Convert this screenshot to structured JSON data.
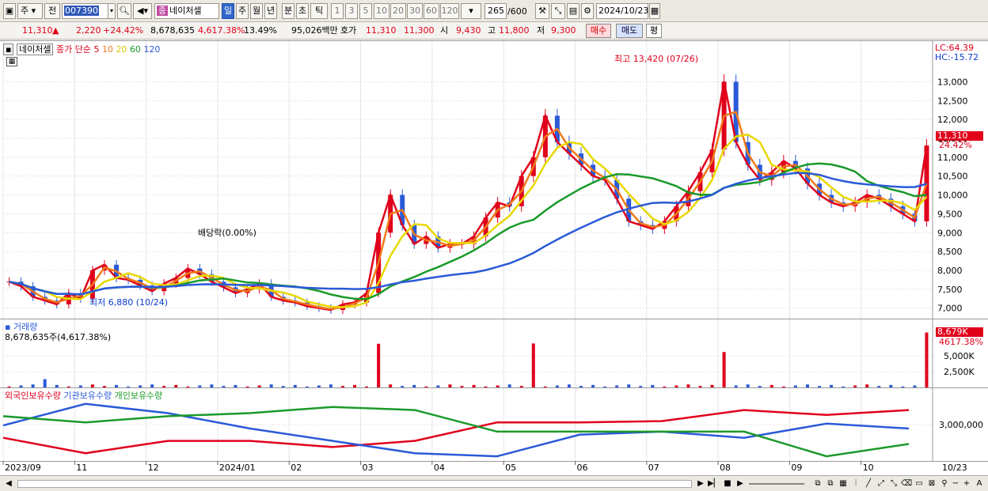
{
  "toolbar": {
    "period_select": "주",
    "prev_label": "전",
    "stock_code": "007390",
    "badge": "종",
    "stock_name": "네이처셀",
    "periods": [
      "일",
      "주",
      "월",
      "년",
      "분",
      "초",
      "틱"
    ],
    "active_period": "일",
    "intervals": [
      "1",
      "3",
      "5",
      "10",
      "20",
      "30",
      "60",
      "120"
    ],
    "count": "265",
    "count_total": "/600",
    "date": "2024/10/23"
  },
  "info": {
    "price": "11,310",
    "change_arrow": "▲",
    "change": "2,220",
    "change_pct": "+24.42%",
    "volume": "8,678,635",
    "volume_pct": "4,617.38%",
    "turnover": "13.49%",
    "amount": "95,026백만",
    "bid_label": "호가",
    "bid1": "11,310",
    "bid2": "11,300",
    "open_label": "시",
    "open": "9,430",
    "high_label": "고",
    "high": "11,800",
    "low_label": "저",
    "low": "9,300",
    "buy_label": "매수",
    "sell_label": "매도",
    "eval_label": "평"
  },
  "price_panel": {
    "name": "네이처셀",
    "legend_prefix": "종가 단순",
    "ma_labels": [
      "5",
      "10",
      "20",
      "60",
      "120"
    ],
    "ma_colors": [
      "#e0001b",
      "#f07a1a",
      "#e8d800",
      "#1a9a2a",
      "#2a5ad8"
    ],
    "lc_label": "LC:64.39",
    "hc_label": "HC:-15.72",
    "high_annot": "최고 13,420 (07/26)",
    "low_annot": "최저 6,880 (10/24)",
    "dividend_annot": "배당락(0.00%)",
    "current_price_tag": "11,310",
    "current_pct_tag": "24.42%"
  },
  "volume_panel": {
    "title": "거래량",
    "value": "8,678,635주(4,617.38%)",
    "tag_value": "8,679K",
    "tag_pct": "4617.38%"
  },
  "holding_panel": {
    "legend": [
      "외국인보유수량",
      "기관보유수량",
      "개인보유수량"
    ],
    "legend_colors": [
      "#e0001b",
      "#2a5ad8",
      "#1a9a2a"
    ],
    "axis_label": "3,000,000"
  },
  "x_axis": {
    "labels": [
      "2023/09",
      "11",
      "12",
      "2024/01",
      "02",
      "03",
      "04",
      "05",
      "06",
      "07",
      "08",
      "09",
      "10",
      "10/23"
    ]
  },
  "chart_data": [
    {
      "type": "candlestick",
      "title": "네이처셀",
      "y_axis_ticks": [
        7000,
        7500,
        8000,
        8500,
        9000,
        9500,
        10000,
        10500,
        11000,
        11500,
        12000,
        12500,
        13000
      ],
      "ylim": [
        6700,
        13700
      ],
      "annotations": [
        {
          "label": "최고 13,420 (07/26)",
          "value": 13420
        },
        {
          "label": "최저 6,880 (10/24)",
          "value": 6880
        }
      ],
      "close_series": [
        7700,
        7580,
        7300,
        7200,
        7100,
        7400,
        7250,
        8000,
        8150,
        7800,
        7750,
        7600,
        7450,
        7650,
        7800,
        8050,
        7900,
        7700,
        7550,
        7400,
        7500,
        7650,
        7300,
        7200,
        7150,
        7050,
        7000,
        6950,
        7100,
        7150,
        7400,
        9000,
        10000,
        9200,
        8700,
        8900,
        8600,
        8700,
        8700,
        8900,
        9400,
        9800,
        9700,
        10500,
        11000,
        12100,
        11400,
        11100,
        10800,
        10500,
        10400,
        9900,
        9300,
        9200,
        9100,
        9300,
        9700,
        10100,
        10600,
        11200,
        13000,
        11400,
        10800,
        10400,
        10600,
        10900,
        10700,
        10300,
        10000,
        9800,
        9700,
        9800,
        10000,
        9900,
        9700,
        9500,
        9300,
        11310
      ]
    },
    {
      "type": "bar",
      "title": "거래량",
      "y_axis_ticks": [
        2500,
        5000
      ],
      "y_unit": "K",
      "spike_values_k": [
        {
          "x": "2023-10-20",
          "value": 1300
        },
        {
          "x": "2024-03-26",
          "value": 6900
        },
        {
          "x": "2024-05-21",
          "value": 6950
        },
        {
          "x": "2024-07-26",
          "value": 5600
        },
        {
          "x": "2024-10-23",
          "value": 8679
        }
      ]
    },
    {
      "type": "line",
      "title": "보유수량",
      "series": [
        {
          "name": "외국인보유수량",
          "values": [
            0.35,
            0.1,
            0.3,
            0.3,
            0.2,
            0.3,
            0.6,
            0.6,
            0.62,
            0.8,
            0.72,
            0.8
          ]
        },
        {
          "name": "기관보유수량",
          "values": [
            0.55,
            0.9,
            0.75,
            0.5,
            0.3,
            0.1,
            0.05,
            0.4,
            0.45,
            0.35,
            0.58,
            0.5
          ]
        },
        {
          "name": "개인보유수량",
          "values": [
            0.7,
            0.6,
            0.7,
            0.75,
            0.85,
            0.8,
            0.45,
            0.45,
            0.45,
            0.45,
            0.05,
            0.25
          ]
        }
      ]
    }
  ]
}
